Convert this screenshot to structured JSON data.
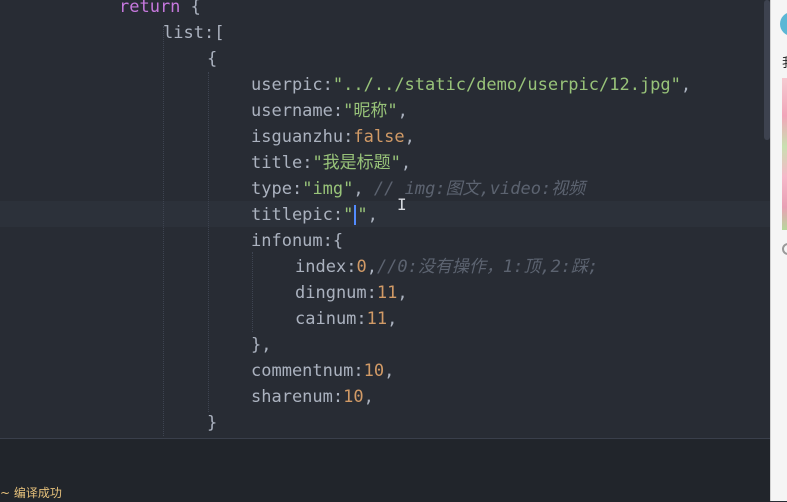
{
  "code": {
    "return_kw": "return",
    "open_brace": " {",
    "list_key": "list",
    "list_open": ":[",
    "obj_open": "{",
    "userpic_key": "userpic",
    "userpic_val": "\"../../static/demo/userpic/12.jpg\"",
    "username_key": "username",
    "username_val": "\"昵称\"",
    "isguanzhu_key": "isguanzhu",
    "isguanzhu_val": "false",
    "title_key": "title",
    "title_val": "\"我是标题\"",
    "type_key": "type",
    "type_val": "\"img\"",
    "type_comment": "// img:图文,video:视频",
    "titlepic_key": "titlepic",
    "titlepic_open_quote": "\"",
    "titlepic_close_quote": "\"",
    "infonum_key": "infonum",
    "infonum_open": ":{",
    "index_key": "index",
    "index_val": "0",
    "index_comment": "//0:没有操作，1:顶,2:踩;",
    "dingnum_key": "dingnum",
    "dingnum_val": "11",
    "cainum_key": "cainum",
    "cainum_val": "11",
    "infonum_close": "},",
    "commentnum_key": "commentnum",
    "commentnum_val": "10",
    "sharenum_key": "sharenum",
    "sharenum_val": "10",
    "obj_close": "}",
    "colon": ":",
    "comma": ","
  },
  "bottom_panel": {
    "text": "~ 编译成功"
  },
  "side_panel": {
    "char": "我"
  },
  "colors": {
    "keyword": "#c678dd",
    "string": "#98c379",
    "number": "#d19a66",
    "comment": "#5c6370",
    "background": "#282c34"
  }
}
